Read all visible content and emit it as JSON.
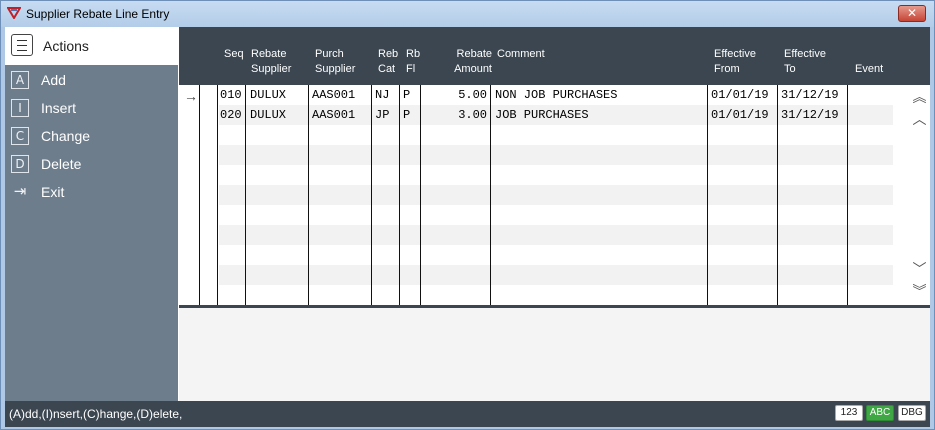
{
  "window": {
    "title": "Supplier Rebate Line Entry",
    "close_label": "✕"
  },
  "sidebar": {
    "title": "Actions",
    "items": [
      {
        "key": "A",
        "label": "Add"
      },
      {
        "key": "I",
        "label": "Insert"
      },
      {
        "key": "C",
        "label": "Change"
      },
      {
        "key": "D",
        "label": "Delete"
      },
      {
        "key": "⇥",
        "label": "Exit"
      }
    ]
  },
  "grid": {
    "columns": [
      {
        "label": "Seq"
      },
      {
        "label": "Rebate\nSupplier"
      },
      {
        "label": "Purch\nSupplier"
      },
      {
        "label": "Reb\nCat"
      },
      {
        "label": "Rb\nFl"
      },
      {
        "label": "Rebate\nAmount"
      },
      {
        "label": "Comment"
      },
      {
        "label": "Effective\nFrom"
      },
      {
        "label": "Effective\nTo"
      },
      {
        "label": "Event"
      }
    ],
    "rows": [
      {
        "current": true,
        "seq": "010",
        "rebate_supplier": "DULUX",
        "purch_supplier": "AAS001",
        "reb_cat": "NJ",
        "rb_fl": "P",
        "amount": "5.00",
        "comment": "NON JOB PURCHASES",
        "from": "01/01/19",
        "to": "31/12/19",
        "event": ""
      },
      {
        "current": false,
        "seq": "020",
        "rebate_supplier": "DULUX",
        "purch_supplier": "AAS001",
        "reb_cat": "JP",
        "rb_fl": "P",
        "amount": "3.00",
        "comment": "JOB PURCHASES",
        "from": "01/01/19",
        "to": "31/12/19",
        "event": ""
      }
    ],
    "current_row_icon": "arrow-right-icon"
  },
  "status": {
    "text": "(A)dd,(I)nsert,(C)hange,(D)elete,",
    "badges": [
      {
        "label": "123",
        "active": false
      },
      {
        "label": "ABC",
        "active": true
      },
      {
        "label": "DBG",
        "active": false
      }
    ]
  }
}
